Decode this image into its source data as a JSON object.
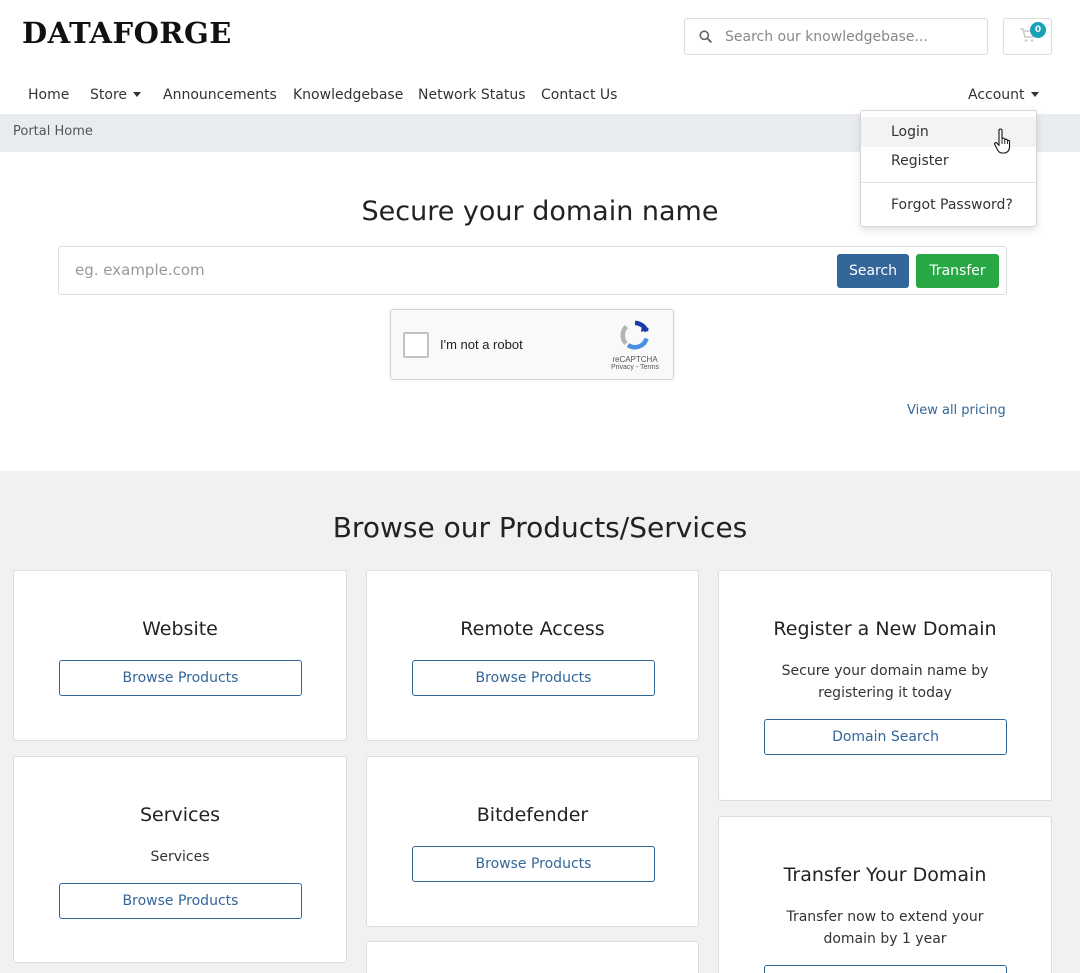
{
  "header": {
    "logo": "DATAFORGE",
    "search_placeholder": "Search our knowledgebase...",
    "cart_count": "0"
  },
  "nav": {
    "items": [
      {
        "label": "Home"
      },
      {
        "label": "Store"
      },
      {
        "label": "Announcements"
      },
      {
        "label": "Knowledgebase"
      },
      {
        "label": "Network Status"
      },
      {
        "label": "Contact Us"
      }
    ],
    "account_label": "Account"
  },
  "account_menu": {
    "items": [
      "Login",
      "Register",
      "Forgot Password?"
    ]
  },
  "breadcrumb": {
    "current": "Portal Home"
  },
  "domain_search": {
    "title": "Secure your domain name",
    "placeholder": "eg. example.com",
    "search_label": "Search",
    "transfer_label": "Transfer",
    "view_pricing": "View all pricing"
  },
  "recaptcha": {
    "label": "I'm not a robot",
    "brand": "reCAPTCHA",
    "terms": "Privacy - Terms"
  },
  "products": {
    "title": "Browse our Products/Services",
    "cards": [
      {
        "title": "Website",
        "button": "Browse Products"
      },
      {
        "title": "Remote Access",
        "button": "Browse Products"
      },
      {
        "title": "Register a New Domain",
        "description_line1": "Secure your domain name by",
        "description_line2": "registering it today",
        "button": "Domain Search"
      },
      {
        "title": "Services",
        "description": "Services",
        "button": "Browse Products"
      },
      {
        "title": "Bitdefender",
        "button": "Browse Products"
      },
      {
        "title": "Transfer Your Domain",
        "description_line1": "Transfer now to extend your",
        "description_line2": "domain by 1 year"
      }
    ]
  },
  "colors": {
    "primary": "#336699",
    "success": "#28a745",
    "badge": "#17a2b8",
    "section_bg": "#f1f1f1"
  }
}
